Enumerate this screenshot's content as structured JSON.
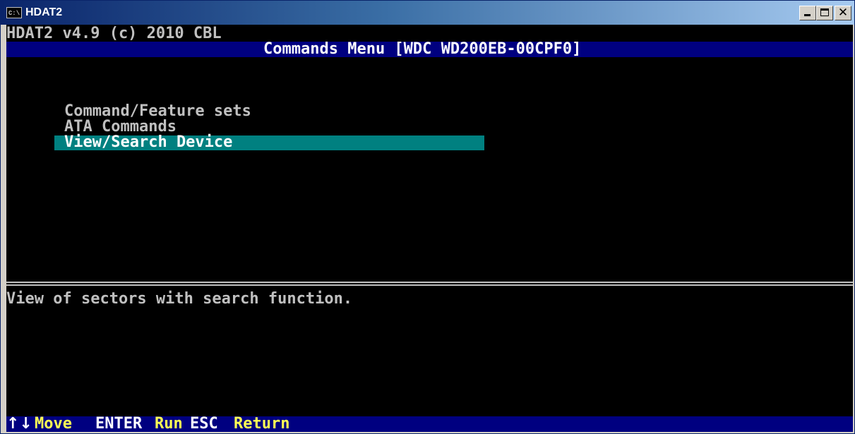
{
  "window": {
    "icon_text": "C:\\",
    "title": "HDAT2"
  },
  "header": {
    "app_version": "HDAT2 v4.9 (c) 2010 CBL",
    "menu_title": "Commands Menu [WDC WD200EB-00CPF0]"
  },
  "menu": {
    "items": [
      {
        "label": "Command/Feature sets"
      },
      {
        "label": "ATA Commands"
      },
      {
        "label": "View/Search Device",
        "selected": true
      }
    ]
  },
  "description": "View of sectors with search function.",
  "footer": {
    "arrows": "↑↓",
    "move": "Move",
    "enter": "ENTER",
    "run": "Run",
    "esc": "ESC",
    "return": "Return"
  },
  "colors": {
    "background": "#000000",
    "text": "#c0c0c0",
    "header_bar": "#000080",
    "selection": "#008080",
    "footer_key": "#ffffff",
    "footer_action": "#ffff55"
  }
}
